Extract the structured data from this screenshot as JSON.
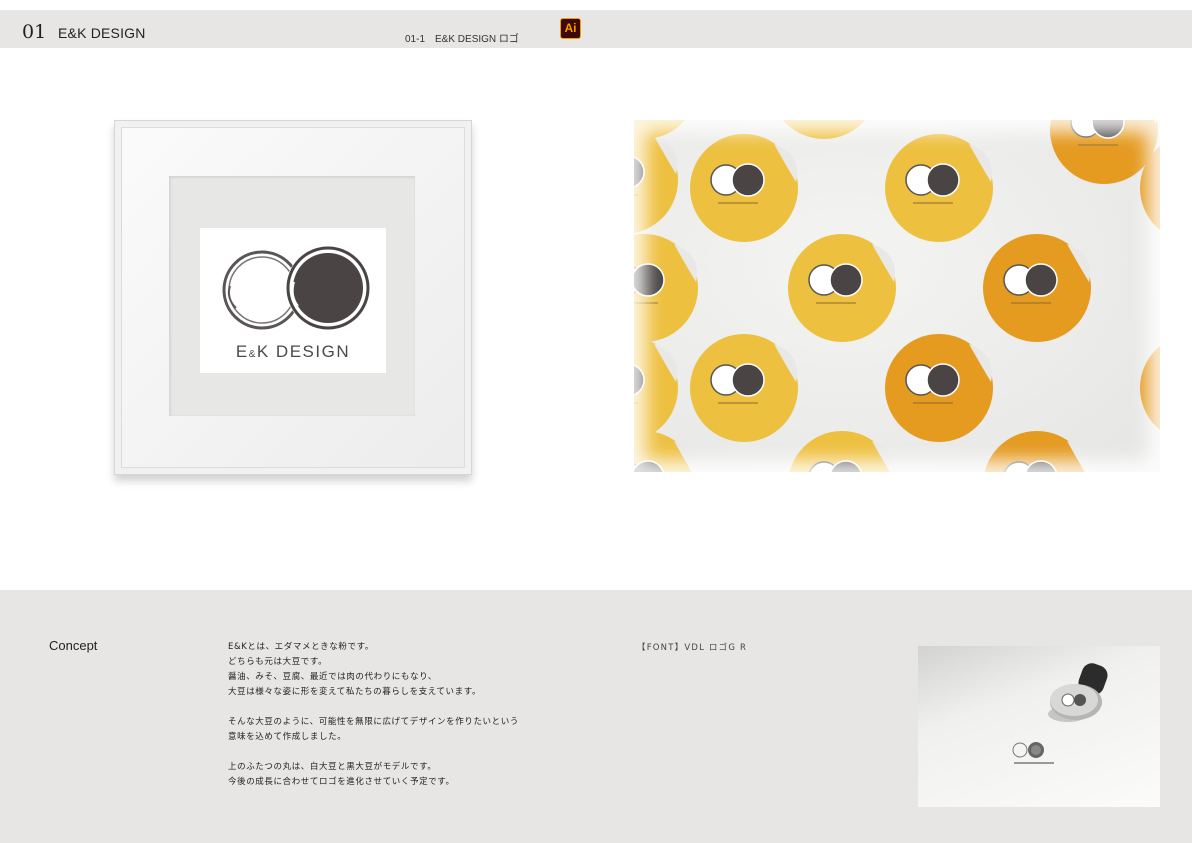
{
  "header": {
    "number": "01",
    "title": "E&K DESIGN",
    "subtitle": "01-1　E&K DESIGN ロゴ",
    "app_badge": "Ai"
  },
  "logo": {
    "brand_main": "E",
    "brand_amp": "&",
    "brand_rest": "K DESIGN"
  },
  "concept": {
    "label": "Concept",
    "paragraphs": [
      [
        "E&Kとは、エダマメときな粉です。",
        "どちらも元は大豆です。",
        "醤油、みそ、豆腐、最近では肉の代わりにもなり、",
        "大豆は様々な姿に形を変えて私たちの暮らしを支えています。"
      ],
      [
        "そんな大豆のように、可能性を無限に広げてデザインを作りたいという",
        "意味を込めて作成しました。"
      ],
      [
        "上のふたつの丸は、白大豆と黒大豆がモデルです。",
        "今後の成長に合わせてロゴを進化させていく予定です。"
      ]
    ],
    "font_note": "【FONT】VDL ロゴG R"
  },
  "colors": {
    "header_bg": "#e7e6e4",
    "sticker_yellow": "#eec040",
    "sticker_orange": "#e59a20",
    "logo_dark": "#4a4444",
    "logo_outline": "#5a5656"
  }
}
